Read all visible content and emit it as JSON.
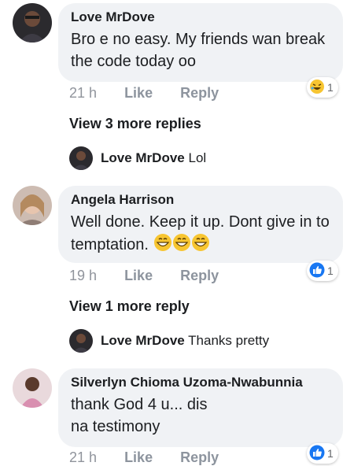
{
  "comments": [
    {
      "author": "Love MrDove",
      "text": "Bro e no easy. My friends wan break the code today oo",
      "time": "21 h",
      "like": "Like",
      "reply": "Reply",
      "reaction": {
        "icon": "laughing-emoji-icon",
        "count": "1"
      },
      "more_replies": "View 3 more replies",
      "latest_reply": {
        "author": "Love MrDove",
        "text": "Lol"
      }
    },
    {
      "author": "Angela Harrison",
      "text": "Well done. Keep it up. Dont give in to temptation.",
      "time": "19 h",
      "like": "Like",
      "reply": "Reply",
      "reaction": {
        "icon": "thumbs-up-icon",
        "count": "1"
      },
      "more_replies": "View 1 more reply",
      "latest_reply": {
        "author": "Love MrDove",
        "text": "Thanks pretty"
      }
    },
    {
      "author": "Silverlyn Chioma Uzoma-Nwabunnia",
      "text": "thank God 4 u... dis na testimony",
      "time": "21 h",
      "like": "Like",
      "reply": "Reply",
      "reaction": {
        "icon": "thumbs-up-icon",
        "count": "1"
      }
    }
  ],
  "colors": {
    "bubble": "#f0f2f5",
    "like_blue": "#1877f2",
    "haha_yellow": "#f7c531"
  }
}
